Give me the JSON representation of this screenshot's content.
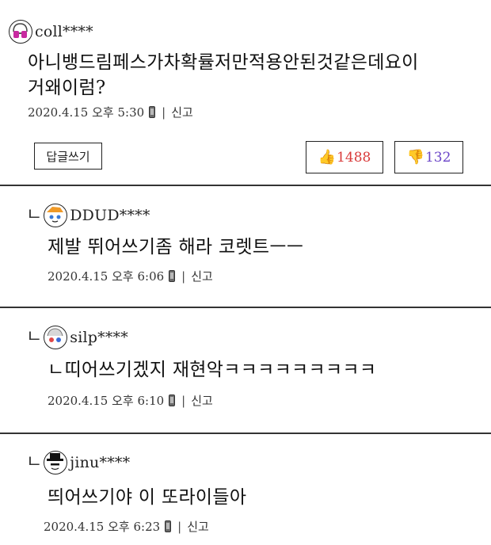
{
  "comments": [
    {
      "username": "coll****",
      "text_line1": "아니뱅드림페스가차확률저만적용안된것같은데요이",
      "text_line2": "거왜이럼?",
      "date": "2020.4.15 오후 5:30",
      "sep": "|",
      "report": "신고",
      "reply_button": "답글쓰기",
      "likes": "1488",
      "dislikes": "132"
    }
  ],
  "replies": [
    {
      "mark": "ㄴ",
      "username": "DDUD****",
      "text": "제발 뛰어쓰기좀 해라 코렛트ㅡㅡ",
      "date": "2020.4.15 오후 6:06",
      "sep": "|",
      "report": "신고"
    },
    {
      "mark": "ㄴ",
      "username": "silp****",
      "text": "ㄴ띠어쓰기겠지 재현악ㅋㅋㅋㅋㅋㅋㅋㅋㅋ",
      "date": "2020.4.15 오후 6:10",
      "sep": "|",
      "report": "신고"
    },
    {
      "mark": "ㄴ",
      "username": "jinu****",
      "text": "띄어쓰기야 이 또라이들아",
      "date": "2020.4.15 오후 6:23",
      "sep": "|",
      "report": "신고"
    }
  ],
  "icons": {
    "like": "thumbs-up-icon",
    "dislike": "thumbs-down-icon",
    "device": "phone-icon"
  },
  "colors": {
    "like": "#d93a3a",
    "dislike": "#6b45c8"
  }
}
